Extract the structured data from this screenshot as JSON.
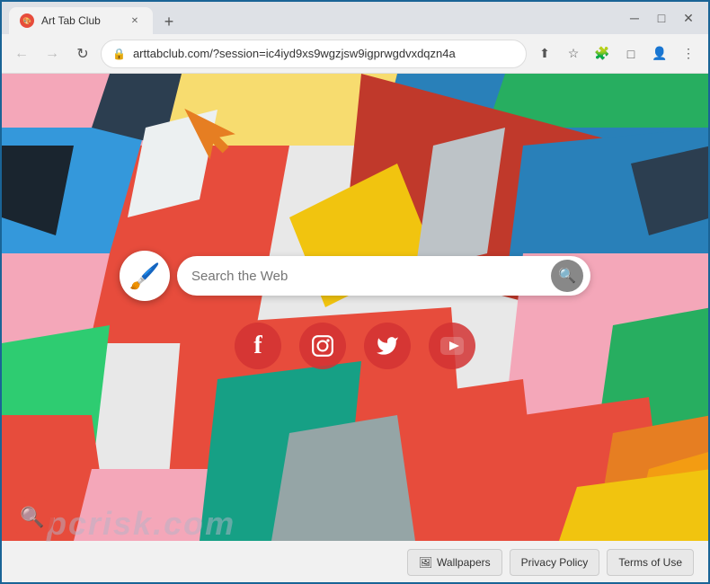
{
  "browser": {
    "tab_title": "Art Tab Club",
    "tab_favicon": "🎨",
    "url": "arttabclub.com/?session=ic4iyd9xs9wgzjsw9igprwgdvxdqzn4a",
    "new_tab_label": "+",
    "window_controls": {
      "minimize": "─",
      "maximize": "□",
      "close": "✕"
    },
    "nav": {
      "back": "←",
      "forward": "→",
      "refresh": "↻",
      "share": "⬆",
      "bookmark": "☆",
      "extensions": "🧩",
      "cast": "□",
      "profile": "👤",
      "menu": "⋮"
    }
  },
  "page": {
    "logo_emoji": "🖌️",
    "search_placeholder": "Search the Web",
    "search_icon": "🔍",
    "social_icons": [
      {
        "name": "facebook",
        "symbol": "f",
        "label": "Facebook"
      },
      {
        "name": "instagram",
        "symbol": "📷",
        "label": "Instagram"
      },
      {
        "name": "twitter",
        "symbol": "🐦",
        "label": "Twitter"
      },
      {
        "name": "youtube",
        "symbol": "▶",
        "label": "YouTube"
      }
    ]
  },
  "footer": {
    "wallpapers_label": "Wallpapers",
    "wallpapers_icon": "🖼",
    "privacy_policy_label": "Privacy Policy",
    "terms_label": "Terms of Use"
  },
  "watermark": {
    "icon": "🔍",
    "text": "pcrisk.com"
  }
}
